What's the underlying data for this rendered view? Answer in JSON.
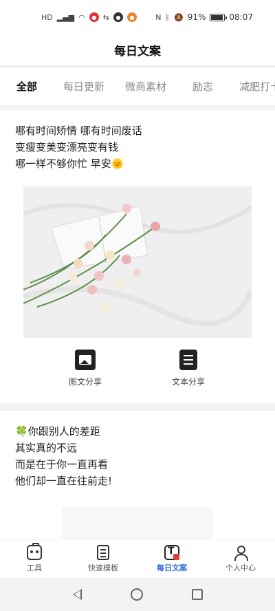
{
  "status_bar": {
    "left_text": "HD",
    "battery": "91%",
    "time": "08:07"
  },
  "header": {
    "title": "每日文案"
  },
  "tabs": [
    {
      "label": "全部",
      "active": true
    },
    {
      "label": "每日更新",
      "active": false
    },
    {
      "label": "微商素材",
      "active": false
    },
    {
      "label": "励志",
      "active": false
    },
    {
      "label": "减肥打卡",
      "active": false
    }
  ],
  "card1": {
    "lines": [
      "哪有时间矫情 哪有时间废话",
      "变瘦变美变漂亮变有钱",
      "哪一样不够你忙 早安"
    ],
    "emoji": "🌞",
    "share_image_label": "图文分享",
    "share_text_label": "文本分享"
  },
  "card2": {
    "emoji": "🍀",
    "lines": [
      "你跟别人的差距",
      "其实真的不远",
      "而是在于你一直再看",
      "他们却一直在往前走!"
    ]
  },
  "bottom_nav": [
    {
      "label": "工具",
      "icon": "tools-icon",
      "active": false
    },
    {
      "label": "快速模板",
      "icon": "template-icon",
      "active": false
    },
    {
      "label": "每日文案",
      "icon": "daily-copy-icon",
      "active": true
    },
    {
      "label": "个人中心",
      "icon": "user-icon",
      "active": false
    }
  ],
  "colors": {
    "accent": "#2f6bd8",
    "background": "#f2f2f2"
  }
}
